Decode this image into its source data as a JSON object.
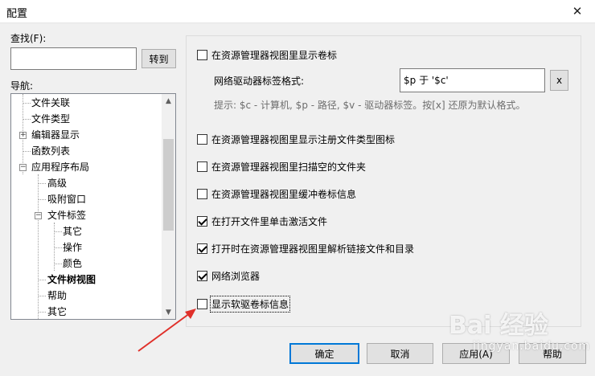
{
  "window": {
    "title": "配置",
    "close_glyph": "✕"
  },
  "find": {
    "label": "查找(F):",
    "value": "",
    "goto_label": "转到"
  },
  "nav": {
    "label": "导航:",
    "items": [
      {
        "label": "文件关联"
      },
      {
        "label": "文件类型"
      },
      {
        "label": "编辑器显示",
        "expander": "+"
      },
      {
        "label": "函数列表"
      },
      {
        "label": "应用程序布局",
        "expander": "−"
      },
      {
        "label": "高级"
      },
      {
        "label": "吸附窗口"
      },
      {
        "label": "文件标签",
        "expander": "−"
      },
      {
        "label": "其它"
      },
      {
        "label": "操作"
      },
      {
        "label": "颜色"
      },
      {
        "label": "文件树视图",
        "selected": true
      },
      {
        "label": "帮助"
      },
      {
        "label": "其它"
      }
    ]
  },
  "options": {
    "show_drive_label": {
      "label": "在资源管理器视图里显示卷标",
      "checked": false
    },
    "label_format_label": "网络驱动器标签格式:",
    "label_format_value": "$p 于 '$c'",
    "clear_label": "x",
    "hint": "提示: $c - 计算机, $p - 路径, $v - 驱动器标签。按[x] 还原为默认格式。",
    "show_registered_icons": {
      "label": "在资源管理器视图里显示注册文件类型图标",
      "checked": false
    },
    "scan_empty_folders": {
      "label": "在资源管理器视图里扫描空的文件夹",
      "checked": false
    },
    "buffer_volume_info": {
      "label": "在资源管理器视图里缓冲卷标信息",
      "checked": false
    },
    "single_click_activate": {
      "label": "在打开文件里单击激活文件",
      "checked": true
    },
    "resolve_links": {
      "label": "打开时在资源管理器视图里解析链接文件和目录",
      "checked": true
    },
    "network_browser": {
      "label": "网络浏览器",
      "checked": true
    },
    "show_floppy_label": {
      "label": "显示软驱卷标信息",
      "checked": false
    }
  },
  "buttons": {
    "ok": "确定",
    "cancel": "取消",
    "apply": "应用(A)",
    "help": "帮助"
  },
  "watermark": {
    "brand": "Bai 经验",
    "sub": "jingyan.baidu.com"
  },
  "colors": {
    "accent": "#0078d7",
    "arrow": "#e0302a"
  }
}
